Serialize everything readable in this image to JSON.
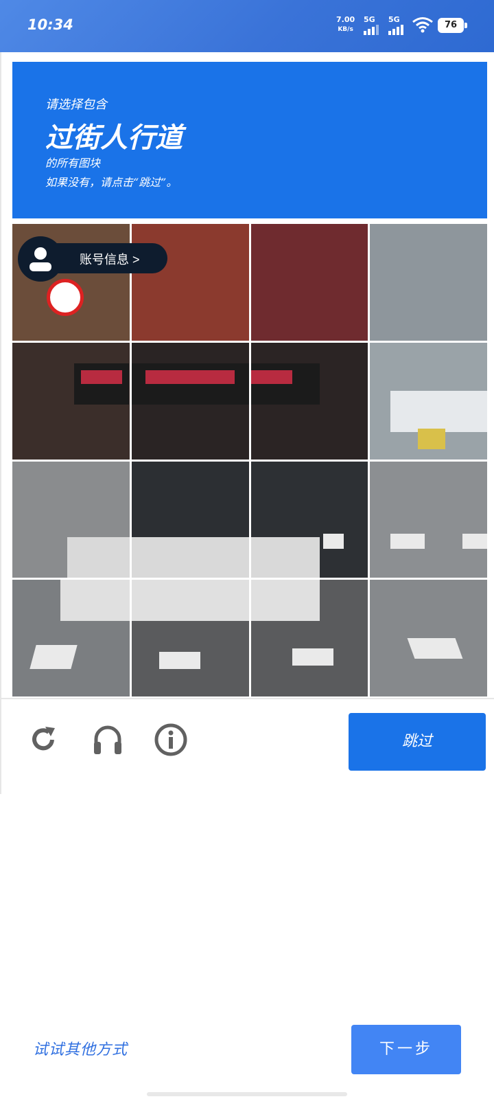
{
  "status_bar": {
    "time": "10:34",
    "net_speed_value": "7.00",
    "net_speed_unit": "KB/s",
    "sim1": "5G",
    "sim2": "5G",
    "battery": "76"
  },
  "captcha": {
    "prompt_line1": "请选择包含",
    "prompt_target": "过街人行道",
    "prompt_line3": "的所有图块",
    "prompt_line4": "如果没有，请点击“跳过”。",
    "grid_rows": 4,
    "grid_cols": 4,
    "skip_label": "跳过",
    "icons": [
      "reload-icon",
      "audio-icon",
      "info-icon"
    ]
  },
  "account_chip": {
    "label": "账号信息 >"
  },
  "footer": {
    "other_method": "试试其他方式",
    "next_label": "下一步"
  },
  "colors": {
    "status_bar": "#3a73d8",
    "banner": "#1a73e8",
    "skip_button": "#1a73e8",
    "next_button": "#4285f4",
    "link": "#2f6fe0"
  }
}
